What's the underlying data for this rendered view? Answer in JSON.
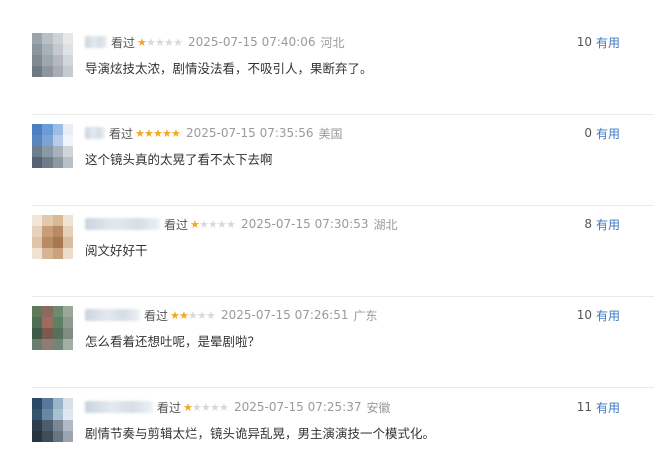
{
  "comments": [
    {
      "username": "ABCDEFG",
      "watched_label": "看过",
      "rating": 1,
      "time": "2025-07-15 07:40:06",
      "location": "河北",
      "text": "导演炫技太浓，剧情没法看，不吸引人，果断弃了。",
      "votes": "10",
      "useful_label": "有用",
      "avatar_colors": [
        "#9aa4ad",
        "#b8bfc5",
        "#cfd3d6",
        "#e6e8ea",
        "#8c969f",
        "#a9b1b8",
        "#c4c9cd",
        "#dfe2e4",
        "#7f8a93",
        "#9ea7ae",
        "#b3b9be",
        "#d2d6d9",
        "#6e7a84",
        "#8d979f",
        "#a7afb5",
        "#c6cbcf"
      ]
    },
    {
      "username": "AB W",
      "watched_label": "看过",
      "rating": 5,
      "time": "2025-07-15 07:35:56",
      "location": "美国",
      "text": "这个镜头真的太晃了看不太下去啊",
      "votes": "0",
      "useful_label": "有用",
      "avatar_colors": [
        "#4a7fc4",
        "#6c9bd6",
        "#9cbde6",
        "#e8eef6",
        "#5a86be",
        "#7aa3d6",
        "#b6cce8",
        "#f0f3f8",
        "#6b7d8f",
        "#8b98a6",
        "#a9b2bc",
        "#d0d5da",
        "#556270",
        "#6f7b88",
        "#8e98a2",
        "#b9c0c7"
      ]
    },
    {
      "username": "ABCDEFGHIJK",
      "watched_label": "看过",
      "rating": 1,
      "time": "2025-07-15 07:30:53",
      "location": "湖北",
      "text": "阅文好好干",
      "votes": "8",
      "useful_label": "有用",
      "avatar_colors": [
        "#f1e6da",
        "#e2c8ad",
        "#d9b896",
        "#efe3d6",
        "#e8d2bb",
        "#c99d78",
        "#b88a63",
        "#e5d0ba",
        "#dfc4a6",
        "#b98b65",
        "#a67852",
        "#d8bea0",
        "#efe2d3",
        "#d5b594",
        "#caa27e",
        "#ecdccb"
      ]
    },
    {
      "username": "ABCDEFGH",
      "watched_label": "看过",
      "rating": 2,
      "time": "2025-07-15 07:26:51",
      "location": "广东",
      "text": "怎么看着还想吐呢，是晕剧啦？",
      "votes": "10",
      "useful_label": "有用",
      "avatar_colors": [
        "#5e7a5a",
        "#8a6a5e",
        "#6b8a70",
        "#9aa89a",
        "#4f6e55",
        "#a06a5c",
        "#5d7f63",
        "#8e9a90",
        "#3f5a46",
        "#7a5a50",
        "#56705b",
        "#7f8c82",
        "#6a7d6e",
        "#8f7d72",
        "#71867a",
        "#a3aea6"
      ]
    },
    {
      "username": "ABCDEFGHI",
      "watched_label": "看过",
      "rating": 1,
      "time": "2025-07-15 07:25:37",
      "location": "安徽",
      "text": "剧情节奏与剪辑太烂，镜头诡异乱晃，男主演演技一个模式化。",
      "votes": "11",
      "useful_label": "有用",
      "avatar_colors": [
        "#2c4a66",
        "#56789a",
        "#9bb3c9",
        "#d6e0ea",
        "#36546e",
        "#6a88a3",
        "#a9bfd2",
        "#e0e7ee",
        "#2f3e4c",
        "#4c5d6d",
        "#7a8896",
        "#b0bac4",
        "#283541",
        "#3f4d5a",
        "#687684",
        "#9aa5b0"
      ]
    }
  ]
}
